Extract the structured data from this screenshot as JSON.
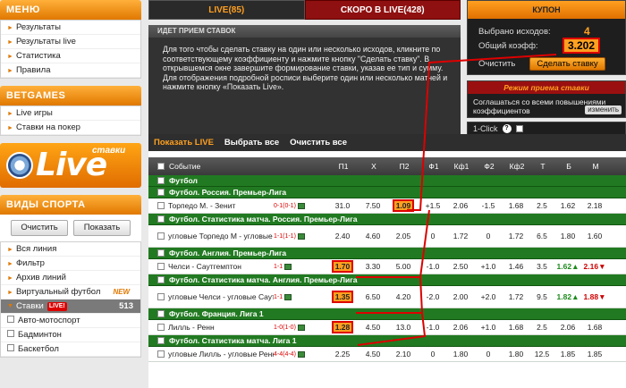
{
  "left": {
    "menu_title": "МЕНЮ",
    "menu_items": [
      "Результаты",
      "Результаты live",
      "Статистика",
      "Правила"
    ],
    "betgames_title": "BETGAMES",
    "betgames_items": [
      "Live игры",
      "Ставки на покер"
    ],
    "banner_stavki": "ставки",
    "banner_live": "Live",
    "sports_title": "ВИДЫ СПОРТА",
    "clear_label": "Очистить",
    "show_label": "Показать",
    "sports_items": [
      "Вся линия",
      "Фильтр",
      "Архив линий",
      "Виртуальный футбол"
    ],
    "new_badge": "NEW",
    "active_item": "Ставки",
    "active_badge": "LIVE!",
    "active_count": "513",
    "sports_more": [
      "Авто-мотоспорт",
      "Бадминтон",
      "Баскетбол"
    ]
  },
  "tabs": {
    "live": "LIVE(85)",
    "soon": "СКОРО В LIVE(428)"
  },
  "info": {
    "title": "ИДЕТ ПРИЕМ СТАВОК",
    "text": "Для того чтобы сделать ставку на один или несколько исходов, кликните по соответствующему коэффициенту и нажмите кнопку \"Сделать ставку\". В открывшемся окне завершите формирование ставки, указав ее тип и сумму. Для отображения подробной росписи выберите один или несколько матчей и нажмите кнопку «Показать Live»."
  },
  "kupon": {
    "title": "КУПОН",
    "selected_label": "Выбрано исходов:",
    "selected_value": "4",
    "total_label": "Общий коэфф:",
    "total_value": "3.202",
    "clear_label": "Очистить",
    "make_bet_label": "Сделать ставку"
  },
  "mode": {
    "title": "Режим приема ставки",
    "text": "Соглашаться со всеми повышениями коэффициентов",
    "change_label": "изменить"
  },
  "oneclick": {
    "label": "1-Click",
    "help": "?"
  },
  "table_actions": {
    "show_live": "Показать LIVE",
    "select_all": "Выбрать все",
    "clear_all": "Очистить все"
  },
  "columns": [
    "Событие",
    "П1",
    "Х",
    "П2",
    "Ф1",
    "Кф1",
    "Ф2",
    "Кф2",
    "Т",
    "Б",
    "М"
  ],
  "colors": {
    "accent": "#ffa020",
    "section": "#217a21",
    "highlight_border": "#d00000"
  },
  "sections": [
    {
      "title": "Футбол",
      "type": "sport"
    },
    {
      "title": "Футбол. Россия. Премьер-Лига",
      "type": "league",
      "rows": [
        {
          "name": "Торпедо М. - Зенит",
          "score": "0-1(0-1)",
          "p1": "31.0",
          "x": "7.50",
          "p2": "1.09",
          "p2_hl": true,
          "f1": "+1.5",
          "kf1": "2.06",
          "f2": "-1.5",
          "kf2": "1.68",
          "t": "2.5",
          "b": "1.62",
          "m": "2.18"
        }
      ]
    },
    {
      "title": "Футбол. Статистика матча. Россия. Премьер-Лига",
      "type": "league",
      "rows": [
        {
          "name": "угловые Торпедо М - угловые Зенит",
          "score": "1-1(1-1)",
          "p1": "2.40",
          "x": "4.60",
          "p2": "2.05",
          "f1": "0",
          "kf1": "1.72",
          "f2": "0",
          "kf2": "1.72",
          "t": "6.5",
          "b": "1.80",
          "m": "1.60",
          "tall": true
        }
      ]
    },
    {
      "title": "Футбол. Англия. Премьер-Лига",
      "type": "league",
      "rows": [
        {
          "name": "Челси - Саутгемптон",
          "score": "1-1",
          "p1": "1.70",
          "p1_hl": true,
          "x": "3.30",
          "p2": "5.00",
          "f1": "-1.0",
          "kf1": "2.50",
          "f2": "+1.0",
          "kf2": "1.46",
          "t": "3.5",
          "b": "1.62",
          "b_up": true,
          "m": "2.16",
          "m_down": true
        }
      ]
    },
    {
      "title": "Футбол. Статистика матча. Англия. Премьер-Лига",
      "type": "league",
      "rows": [
        {
          "name": "угловые Челси - угловые Саутгемптон",
          "score": "1-1",
          "p1": "1.35",
          "p1_hl": true,
          "x": "6.50",
          "p2": "4.20",
          "f1": "-2.0",
          "kf1": "2.00",
          "f2": "+2.0",
          "kf2": "1.72",
          "t": "9.5",
          "b": "1.82",
          "b_up": true,
          "m": "1.88",
          "m_down": true,
          "tall": true
        }
      ]
    },
    {
      "title": "Футбол. Франция. Лига 1",
      "type": "league",
      "rows": [
        {
          "name": "Лилль - Ренн",
          "score": "1-0(1-0)",
          "p1": "1.28",
          "p1_hl": true,
          "x": "4.50",
          "p2": "13.0",
          "f1": "-1.0",
          "kf1": "2.06",
          "f2": "+1.0",
          "kf2": "1.68",
          "t": "2.5",
          "b": "2.06",
          "m": "1.68"
        }
      ]
    },
    {
      "title": "Футбол. Статистика матча. Лига 1",
      "type": "league",
      "rows": [
        {
          "name": "угловые Лилль - угловые Ренн",
          "score": "4-4(4-4)",
          "p1": "2.25",
          "x": "4.50",
          "p2": "2.10",
          "f1": "0",
          "kf1": "1.80",
          "f2": "0",
          "kf2": "1.80",
          "t": "12.5",
          "b": "1.85",
          "m": "1.85"
        }
      ]
    }
  ]
}
